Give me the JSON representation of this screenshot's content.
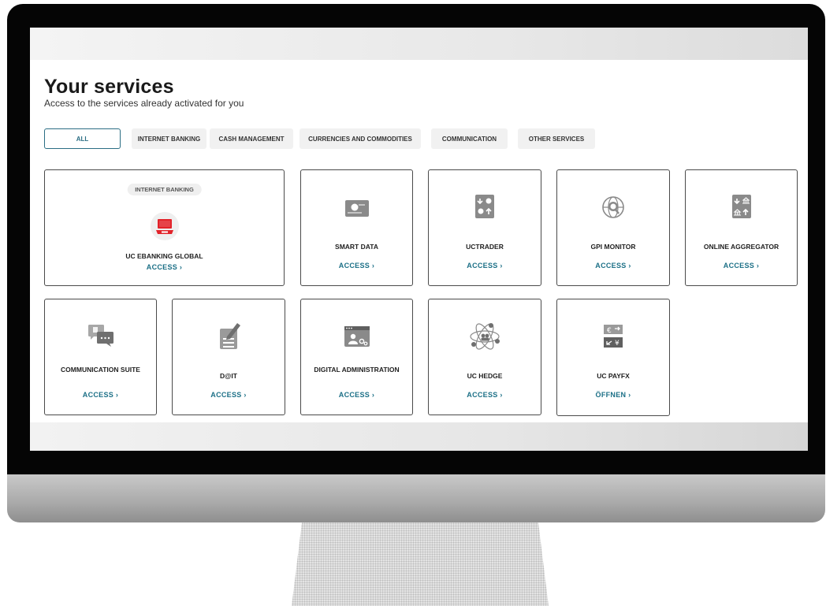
{
  "header": {
    "title": "Your services",
    "subtitle": "Access to the services already activated for you"
  },
  "tabs": [
    {
      "label": "ALL",
      "active": true
    },
    {
      "label": "INTERNET BANKING",
      "active": false
    },
    {
      "label": "CASH MANAGEMENT",
      "active": false
    },
    {
      "label": "CURRENCIES AND COMMODITIES",
      "active": false
    },
    {
      "label": "COMMUNICATION",
      "active": false
    },
    {
      "label": "OTHER SERVICES",
      "active": false
    }
  ],
  "featured": {
    "badge": "INTERNET BANKING",
    "name": "UC EBANKING GLOBAL",
    "action": "ACCESS",
    "icon": "laptop-icon"
  },
  "services_row1": [
    {
      "name": "SMART DATA",
      "action": "ACCESS",
      "icon": "data-card-icon"
    },
    {
      "name": "UCTRADER",
      "action": "ACCESS",
      "icon": "currency-exchange-icon"
    },
    {
      "name": "GPI MONITOR",
      "action": "ACCESS",
      "icon": "globe-search-icon"
    },
    {
      "name": "ONLINE AGGREGATOR",
      "action": "ACCESS",
      "icon": "bank-transfer-icon"
    }
  ],
  "services_row2": [
    {
      "name": "COMMUNICATION SUITE",
      "action": "ACCESS",
      "icon": "chat-bubbles-icon"
    },
    {
      "name": "D@IT",
      "action": "ACCESS",
      "icon": "document-edit-icon"
    },
    {
      "name": "DIGITAL ADMINISTRATION",
      "action": "ACCESS",
      "icon": "admin-settings-icon"
    },
    {
      "name": "UC HEDGE",
      "action": "ACCESS",
      "icon": "atom-currency-icon"
    },
    {
      "name": "UC PAYFX",
      "action": "ÖFFNEN",
      "icon": "euro-yen-exchange-icon"
    }
  ],
  "colors": {
    "accent": "#1b6f86",
    "brand_red": "#e2232a",
    "icon_gray": "#8a8a8a"
  },
  "chevron": "›"
}
